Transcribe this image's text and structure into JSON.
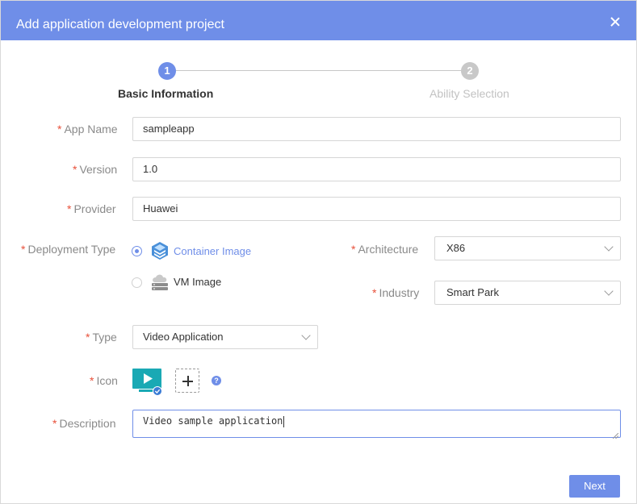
{
  "dialog": {
    "title": "Add application development project",
    "close_icon": "close-icon"
  },
  "steps": [
    {
      "number": "1",
      "label": "Basic Information",
      "state": "active"
    },
    {
      "number": "2",
      "label": "Ability Selection",
      "state": "inactive"
    }
  ],
  "form": {
    "required_mark": "*",
    "app_name": {
      "label": "App Name",
      "value": "sampleapp"
    },
    "version": {
      "label": "Version",
      "value": "1.0"
    },
    "provider": {
      "label": "Provider",
      "value": "Huawei"
    },
    "deployment_type": {
      "label": "Deployment Type",
      "options": [
        {
          "label": "Container Image",
          "icon": "container-image-icon",
          "selected": true
        },
        {
          "label": "VM Image",
          "icon": "vm-image-icon",
          "selected": false
        }
      ]
    },
    "architecture": {
      "label": "Architecture",
      "value": "X86"
    },
    "industry": {
      "label": "Industry",
      "value": "Smart Park"
    },
    "type": {
      "label": "Type",
      "value": "Video Application"
    },
    "icon": {
      "label": "Icon",
      "preview_icon": "video-play-icon",
      "add_icon": "plus-icon",
      "help_icon": "question-icon",
      "help_text": "?"
    },
    "description": {
      "label": "Description",
      "value": "Video sample application"
    }
  },
  "footer": {
    "next_label": "Next"
  },
  "colors": {
    "accent": "#6f8ee8",
    "required": "#e8503a",
    "icon_teal": "#1aa9b4",
    "icon_check": "#3a7bd5"
  }
}
